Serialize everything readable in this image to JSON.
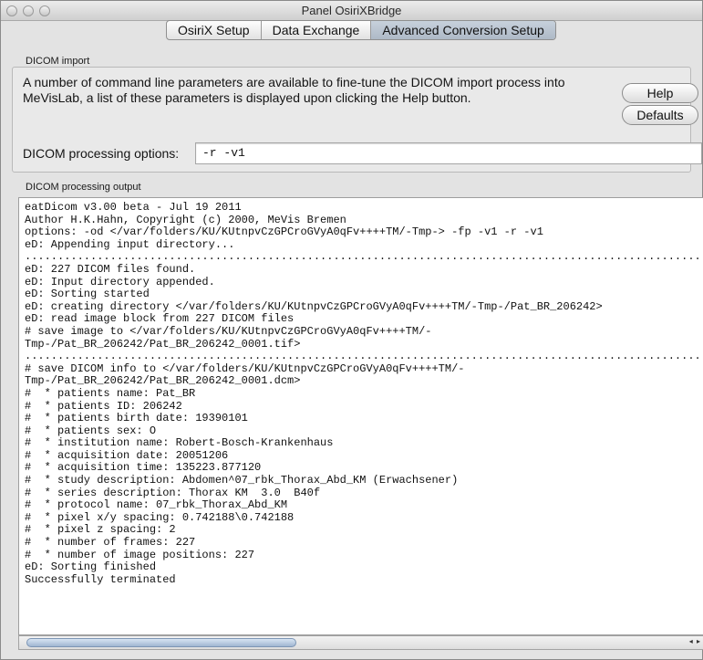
{
  "window": {
    "title": "Panel OsiriXBridge"
  },
  "tabs": [
    {
      "label": "OsiriX Setup"
    },
    {
      "label": "Data Exchange"
    },
    {
      "label": "Advanced Conversion Setup",
      "selected": true
    }
  ],
  "import_group": {
    "label": "DICOM import",
    "description": "A number of command line parameters are available to fine-tune the DICOM import process into MeVisLab, a list of these parameters is displayed upon clicking the Help button.",
    "help_label": "Help",
    "defaults_label": "Defaults",
    "options_label": "DICOM processing options:",
    "options_value": "-r -v1"
  },
  "output_group": {
    "label": "DICOM processing output",
    "lines": [
      "eatDicom v3.00 beta - Jul 19 2011",
      "Author H.K.Hahn, Copyright (c) 2000, MeVis Bremen",
      "options: -od </var/folders/KU/KUtnpvCzGPCroGVyA0qFv++++TM/-Tmp-> -fp -v1 -r -v1",
      "eD: Appending input directory...",
      "........................................................................................................",
      "eD: 227 DICOM files found.",
      "eD: Input directory appended.",
      "eD: Sorting started",
      "eD: creating directory </var/folders/KU/KUtnpvCzGPCroGVyA0qFv++++TM/-Tmp-/Pat_BR_206242>",
      "eD: read image block from 227 DICOM files",
      "# save image to </var/folders/KU/KUtnpvCzGPCroGVyA0qFv++++TM/-",
      "Tmp-/Pat_BR_206242/Pat_BR_206242_0001.tif>",
      "........................................................................................................",
      "# save DICOM info to </var/folders/KU/KUtnpvCzGPCroGVyA0qFv++++TM/-",
      "Tmp-/Pat_BR_206242/Pat_BR_206242_0001.dcm>",
      "#  * patients name: Pat_BR",
      "#  * patients ID: 206242",
      "#  * patients birth date: 19390101",
      "#  * patients sex: O",
      "#  * institution name: Robert-Bosch-Krankenhaus",
      "#  * acquisition date: 20051206",
      "#  * acquisition time: 135223.877120",
      "#  * study description: Abdomen^07_rbk_Thorax_Abd_KM (Erwachsener)",
      "#  * series description: Thorax KM  3.0  B40f",
      "#  * protocol name: 07_rbk_Thorax_Abd_KM",
      "#  * pixel x/y spacing: 0.742188\\0.742188",
      "#  * pixel z spacing: 2",
      "#  * number of frames: 227",
      "#  * number of image positions: 227",
      "eD: Sorting finished",
      "Successfully terminated"
    ]
  },
  "scrollbar": {
    "arrows": "◂ ▸"
  }
}
